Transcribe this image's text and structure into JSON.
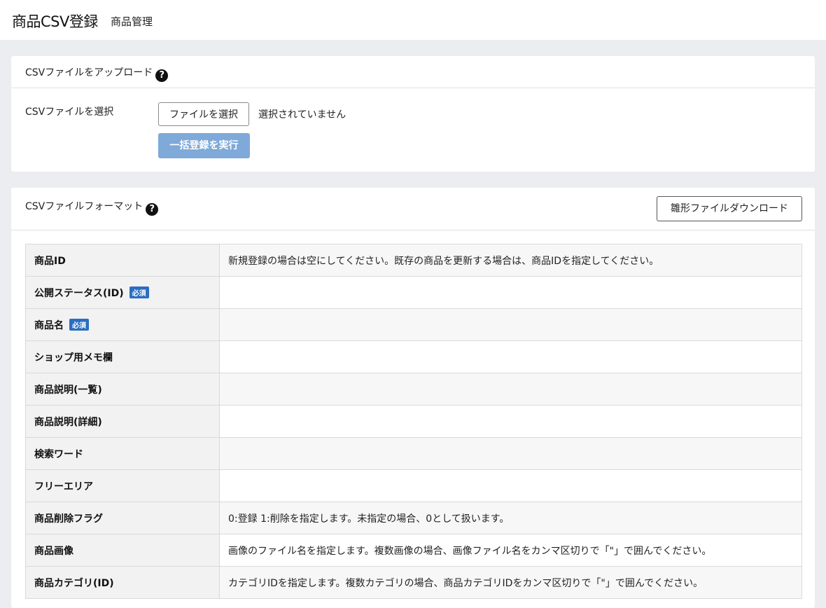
{
  "header": {
    "title": "商品CSV登録",
    "subtitle": "商品管理"
  },
  "upload_card": {
    "title": "CSVファイルをアップロード",
    "help_icon": "question-circle-icon",
    "file_label": "CSVファイルを選択",
    "file_button": "ファイルを選択",
    "file_status": "選択されていません",
    "submit_button": "一括登録を実行"
  },
  "format_card": {
    "title": "CSVファイルフォーマット",
    "help_icon": "question-circle-icon",
    "download_button": "雛形ファイルダウンロード",
    "required_badge": "必須",
    "rows": [
      {
        "key": "商品ID",
        "required": false,
        "desc": "新規登録の場合は空にしてください。既存の商品を更新する場合は、商品IDを指定してください。"
      },
      {
        "key": "公開ステータス(ID)",
        "required": true,
        "desc": ""
      },
      {
        "key": "商品名",
        "required": true,
        "desc": ""
      },
      {
        "key": "ショップ用メモ欄",
        "required": false,
        "desc": ""
      },
      {
        "key": "商品説明(一覧)",
        "required": false,
        "desc": ""
      },
      {
        "key": "商品説明(詳細)",
        "required": false,
        "desc": ""
      },
      {
        "key": "検索ワード",
        "required": false,
        "desc": ""
      },
      {
        "key": "フリーエリア",
        "required": false,
        "desc": ""
      },
      {
        "key": "商品削除フラグ",
        "required": false,
        "desc": "0:登録 1:削除を指定します。未指定の場合、0として扱います。"
      },
      {
        "key": "商品画像",
        "required": false,
        "desc": "画像のファイル名を指定します。複数画像の場合、画像ファイル名をカンマ区切りで「\"」で囲んでください。"
      },
      {
        "key": "商品カテゴリ(ID)",
        "required": false,
        "desc": "カテゴリIDを指定します。複数カテゴリの場合、商品カテゴリIDをカンマ区切りで「\"」で囲んでください。"
      }
    ]
  },
  "colors": {
    "background": "#ebedf0",
    "primary_button_disabled": "#7ea9d9",
    "required_badge": "#2a6ec0"
  }
}
